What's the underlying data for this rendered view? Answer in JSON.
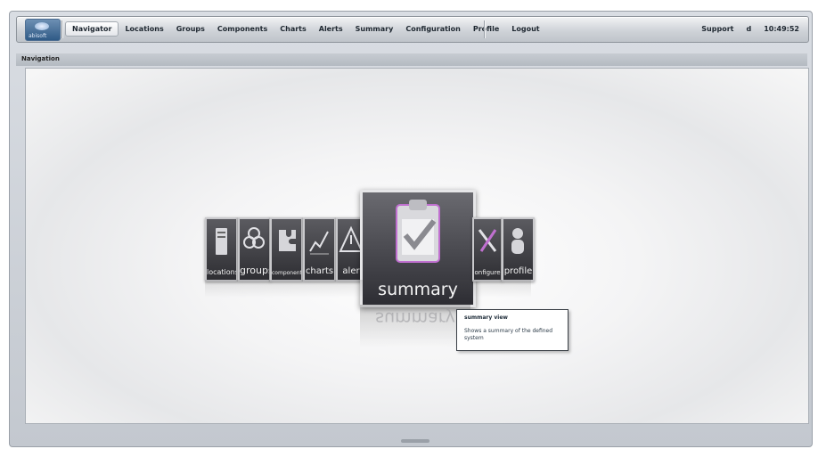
{
  "topbar": {
    "logo_text": "abisoft",
    "menu": [
      {
        "label": "Navigator",
        "active": true
      },
      {
        "label": "Locations"
      },
      {
        "label": "Groups"
      },
      {
        "label": "Components"
      },
      {
        "label": "Charts"
      },
      {
        "label": "Alerts"
      },
      {
        "label": "Summary"
      },
      {
        "label": "Configuration"
      },
      {
        "label": "Profile"
      },
      {
        "label": "Logout"
      }
    ],
    "support_label": "Support",
    "user": "d",
    "time": "10:49:52"
  },
  "panel": {
    "title": "Navigation"
  },
  "carousel": {
    "tiles": [
      {
        "label": "locations",
        "icon": "server-icon"
      },
      {
        "label": "groups",
        "icon": "group-icon"
      },
      {
        "label": "components",
        "icon": "puzzle-icon"
      },
      {
        "label": "charts",
        "icon": "chart-icon"
      },
      {
        "label": "alerts",
        "icon": "warning-icon"
      },
      {
        "label": "summary",
        "icon": "clipboard-check-icon"
      },
      {
        "label": "configure",
        "icon": "tools-icon"
      },
      {
        "label": "profile",
        "icon": "person-icon"
      }
    ],
    "featured_label": "summary",
    "tile_labels_visible": {
      "locations": "locations",
      "groups": "groups",
      "components": "components",
      "charts": "charts",
      "alerts": "aler",
      "configure": "onfigure",
      "profile": "profile"
    }
  },
  "tooltip": {
    "title": "summary view",
    "description": "Shows a summary of the defined system"
  },
  "colors": {
    "accent_glow": "#c070d0",
    "tile_bg": "#3e3e44"
  }
}
